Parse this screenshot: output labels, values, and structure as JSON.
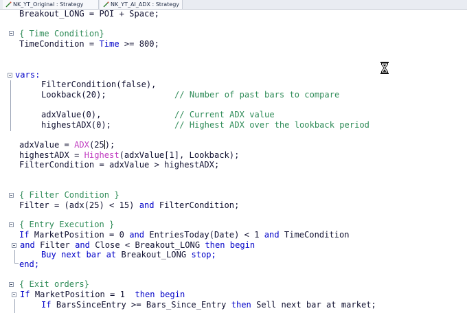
{
  "tabs": [
    {
      "label": "NK_YT_Original : Strategy"
    },
    {
      "label": "NK_YT_AI_ADX : Strategy"
    }
  ],
  "code": {
    "line_breakout": "Breakout_LONG = POI + Space;",
    "comment_time": "{ Time Condition}",
    "line_timecond_a": "TimeCondition = ",
    "kw_time": "Time",
    "line_timecond_b": " >= 800;",
    "kw_vars": "vars:",
    "vars_filter": "FilterCondition(false),",
    "vars_lookback": "Lookback(20);",
    "comment_lookback": "// Number of past bars to compare",
    "vars_adx": "adxValue(0),",
    "comment_adx": "// Current ADX value",
    "vars_highest": "highestADX(0);",
    "comment_highest": "// Highest ADX over the lookback period",
    "assign_adx_a": "adxValue = ",
    "fn_adx": "ADX",
    "assign_adx_b": "(25",
    "assign_adx_c": ");",
    "assign_highest_a": "highestADX = ",
    "fn_highest": "Highest",
    "assign_highest_b": "(adxValue[1], Lookback);",
    "assign_filtercond": "FilterCondition = adxValue > highestADX;",
    "comment_filter": "{ Filter Condition }",
    "filter_a": "Filter = (adx(25) < 15) ",
    "kw_and1": "and",
    "filter_b": " FilterCondition;",
    "comment_entry": "{ Entry Execution }",
    "kw_if1": "If",
    "entry_a": " MarketPosition = 0 ",
    "kw_and2": "and",
    "entry_b": " EntriesToday(Date) < 1 ",
    "kw_and3": "and",
    "entry_c": " TimeCondition",
    "kw_and4": "and",
    "entry_d": " Filter ",
    "kw_and5": "and",
    "entry_e": " Close < Breakout_LONG ",
    "kw_then1": "then begin",
    "buy_a": "Buy next bar at",
    "buy_b": " Breakout_LONG ",
    "buy_c": "stop;",
    "kw_end": "end;",
    "comment_exit": "{ Exit orders}",
    "kw_if2": "If",
    "exit_a": " MarketPosition = 1  ",
    "kw_then2": "then begin",
    "kw_if3": "If",
    "exit_b": " BarsSinceEntry >= Bars_Since_Entry ",
    "kw_then3": "then",
    "exit_c": " Sell next bar at market;"
  },
  "colors": {
    "keyword": "#0000c8",
    "comment": "#2e8b57",
    "function": "#c03cc0",
    "text": "#101030"
  },
  "icons": [
    "strategy-tab-icon",
    "hourglass-icon",
    "fold-toggle-icon"
  ]
}
